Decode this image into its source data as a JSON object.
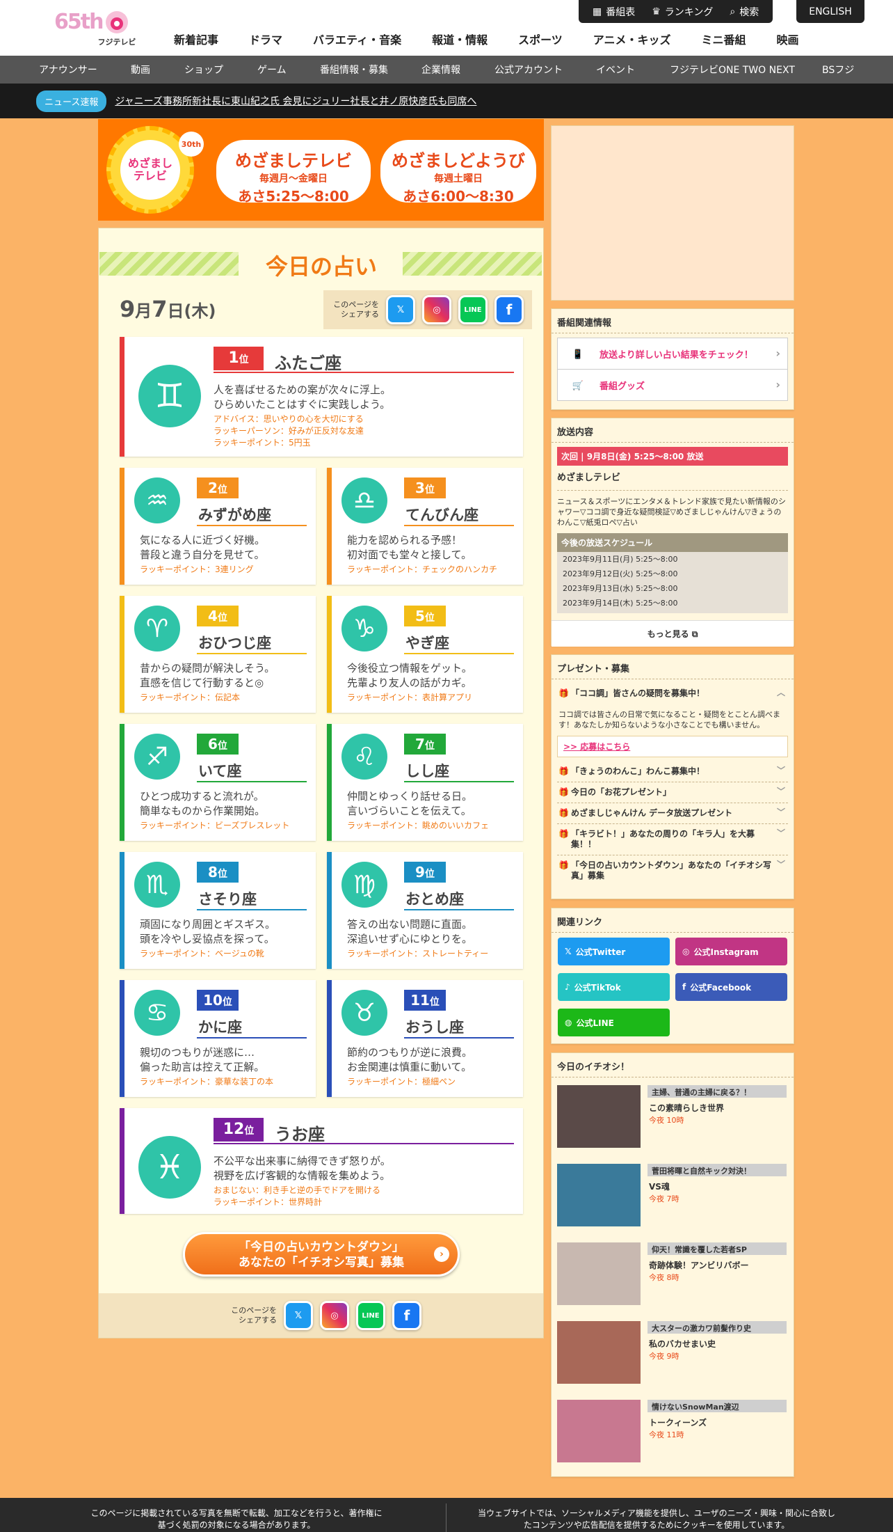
{
  "header": {
    "logo_65": "65th",
    "logo_fuji": "フジテレビ",
    "top_links": [
      "番組表",
      "ランキング",
      "検索"
    ],
    "english": "ENGLISH",
    "main_nav": [
      "新着記事",
      "ドラマ",
      "バラエティ・音楽",
      "報道・情報",
      "スポーツ",
      "アニメ・キッズ",
      "ミニ番組",
      "映画"
    ],
    "sub_nav": [
      "アナウンサー",
      "動画",
      "ショップ",
      "ゲーム",
      "番組情報・募集",
      "企業情報",
      "公式アカウント",
      "イベント",
      "フジテレビONE TWO NEXT",
      "BSフジ"
    ]
  },
  "ticker": {
    "badge": "ニュース速報",
    "text": "ジャニーズ事務所新社長に東山紀之氏 会見にジュリー社長と井ノ原快彦氏も同席へ"
  },
  "banner": {
    "logo_line1": "めざまし",
    "logo_line2": "テレビ",
    "badge": "30th",
    "pill1": {
      "title": "めざましテレビ",
      "days": "毎週月〜金曜日",
      "time": "あさ5:25〜8:00"
    },
    "pill2": {
      "title": "めざましどようび",
      "days": "毎週土曜日",
      "time": "あさ6:00〜8:30"
    }
  },
  "page": {
    "title": "今日の占い",
    "date_month": "9",
    "date_day": "7",
    "date_month_unit": "月",
    "date_day_unit": "日",
    "date_weekday": "(木)",
    "share_label": "このページを シェアする",
    "share_buttons": {
      "twitter": "𝕏",
      "instagram": "◎",
      "line": "LINE",
      "facebook": "f"
    },
    "countdown_line1": "「今日の占いカウントダウン」",
    "countdown_line2": "あなたの「イチオシ写真」募集"
  },
  "fortunes": [
    {
      "rank": "1",
      "sign": "ふたご座",
      "glyph": "♊",
      "text1": "人を喜ばせるための案が次々に浮上。",
      "text2": "ひらめいたことはすぐに実践しよう。",
      "luck": [
        "アドバイス：思いやりの心を大切にする",
        "ラッキーパーソン：好みが正反対な友達",
        "ラッキーポイント：5円玉"
      ],
      "color": "#e63a3a"
    },
    {
      "rank": "2",
      "sign": "みずがめ座",
      "glyph": "♒",
      "text1": "気になる人に近づく好機。",
      "text2": "普段と違う自分を見せて。",
      "luck": [
        "ラッキーポイント：3連リング"
      ],
      "color": "#f5901e"
    },
    {
      "rank": "3",
      "sign": "てんびん座",
      "glyph": "♎",
      "text1": "能力を認められる予感！",
      "text2": "初対面でも堂々と接して。",
      "luck": [
        "ラッキーポイント：チェックのハンカチ"
      ],
      "color": "#f5901e"
    },
    {
      "rank": "4",
      "sign": "おひつじ座",
      "glyph": "♈",
      "text1": "昔からの疑問が解決しそう。",
      "text2": "直感を信じて行動すると◎",
      "luck": [
        "ラッキーポイント：伝記本"
      ],
      "color": "#f2bd16"
    },
    {
      "rank": "5",
      "sign": "やぎ座",
      "glyph": "♑",
      "text1": "今後役立つ情報をゲット。",
      "text2": "先輩より友人の話がカギ。",
      "luck": [
        "ラッキーポイント：表計算アプリ"
      ],
      "color": "#f2bd16"
    },
    {
      "rank": "6",
      "sign": "いて座",
      "glyph": "♐",
      "text1": "ひとつ成功すると流れが。",
      "text2": "簡単なものから作業開始。",
      "luck": [
        "ラッキーポイント：ビーズブレスレット"
      ],
      "color": "#22a83a"
    },
    {
      "rank": "7",
      "sign": "しし座",
      "glyph": "♌",
      "text1": "仲間とゆっくり話せる日。",
      "text2": "言いづらいことを伝えて。",
      "luck": [
        "ラッキーポイント：眺めのいいカフェ"
      ],
      "color": "#22a83a"
    },
    {
      "rank": "8",
      "sign": "さそり座",
      "glyph": "♏",
      "text1": "頑固になり周囲とギスギス。",
      "text2": "頭を冷やし妥協点を探って。",
      "luck": [
        "ラッキーポイント：ベージュの靴"
      ],
      "color": "#1b8fc4"
    },
    {
      "rank": "9",
      "sign": "おとめ座",
      "glyph": "♍",
      "text1": "答えの出ない問題に直面。",
      "text2": "深追いせず心にゆとりを。",
      "luck": [
        "ラッキーポイント：ストレートティー"
      ],
      "color": "#1b8fc4"
    },
    {
      "rank": "10",
      "sign": "かに座",
      "glyph": "♋",
      "text1": "親切のつもりが迷惑に…",
      "text2": "偏った助言は控えて正解。",
      "luck": [
        "ラッキーポイント：豪華な装丁の本"
      ],
      "color": "#2a4fb8"
    },
    {
      "rank": "11",
      "sign": "おうし座",
      "glyph": "♉",
      "text1": "節約のつもりが逆に浪費。",
      "text2": "お金関連は慎重に動いて。",
      "luck": [
        "ラッキーポイント：極細ペン"
      ],
      "color": "#2a4fb8"
    },
    {
      "rank": "12",
      "sign": "うお座",
      "glyph": "♓",
      "text1": "不公平な出来事に納得できず怒りが。",
      "text2": "視野を広げ客観的な情報を集めよう。",
      "luck": [
        "おまじない：利き手と逆の手でドアを開ける",
        "ラッキーポイント：世界時計"
      ],
      "color": "#7a1f9e"
    }
  ],
  "rank_suffix": "位",
  "sidebar": {
    "related_title": "番組関連情報",
    "related_items": [
      "放送より詳しい占い結果をチェック！",
      "番組グッズ"
    ],
    "broadcast_title": "放送内容",
    "next_label": "次回 | 9月8日(金) 5:25〜8:00 放送",
    "program_name": "めざましテレビ",
    "program_desc": "ニュース＆スポーツにエンタメ＆トレンド家族で見たい新情報のシャワー▽ココ調で身近な疑問検証▽めざましじゃんけん▽きょうのわんこ▽紙兎ロペ▽占い",
    "schedule_title": "今後の放送スケジュール",
    "schedule": [
      "2023年9月11日(月) 5:25〜8:00",
      "2023年9月12日(火) 5:25〜8:00",
      "2023年9月13日(水) 5:25〜8:00",
      "2023年9月14日(木) 5:25〜8:00"
    ],
    "more": "もっと見る",
    "present_title": "プレゼント・募集",
    "present_open": "「ココ調」皆さんの疑問を募集中！",
    "present_body": "ココ調では皆さんの日常で気になること・疑問をとことん調べます！あなたしか知らないような小さなことでも構いません。",
    "present_link": ">> 応募はこちら",
    "present_items": [
      "「きょうのわんこ」わんこ募集中！",
      "今日の「お花プレゼント」",
      "めざましじゃんけん データ放送プレゼント",
      "「キラビト！」あなたの周りの「キラ人」を大募集！！",
      "「今日の占いカウントダウン」あなたの「イチオシ写真」募集"
    ],
    "links_title": "関連リンク",
    "links": [
      "公式Twitter",
      "公式Instagram",
      "公式TikTok",
      "公式Facebook",
      "公式LINE"
    ],
    "pick_title": "今日のイチオシ！",
    "picks": [
      {
        "tag": "主婦、普通の主婦に戻る？！",
        "program": "この素晴らしき世界",
        "time": "今夜 10時"
      },
      {
        "tag": "菅田将暉と自然キック対決！",
        "program": "VS魂",
        "time": "今夜 7時"
      },
      {
        "tag": "仰天！常識を覆した若者SP",
        "program": "奇跡体験！アンビリバボー",
        "time": "今夜 8時"
      },
      {
        "tag": "大スターの激カワ前髪作り史",
        "program": "私のバカせまい史",
        "time": "今夜 9時"
      },
      {
        "tag": "情けないSnowMan渡辺",
        "program": "トークィーンズ",
        "time": "今夜 11時"
      }
    ]
  },
  "footer": {
    "left": "このページに掲載されている写真を無断で転載、加工などを行うと、著作権に基づく処罰の対象になる場合があります。",
    "right": "当ウェブサイトでは、ソーシャルメディア機能を提供し、ユーザのニーズ・興味・関心に合致したコンテンツや広告配信を提供するためにクッキーを使用しています。"
  }
}
